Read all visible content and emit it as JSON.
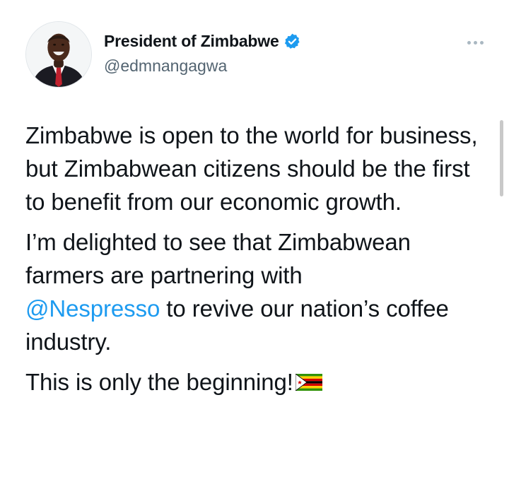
{
  "author": {
    "display_name": "President of Zimbabwe",
    "handle": "@edmnangagwa",
    "verified": true,
    "verified_color": "#1d9bf0"
  },
  "tweet": {
    "p1": "Zimbabwe is open to the world for business, but Zimbabwean citizens should be the first to benefit from our economic growth.",
    "p2_before": "I’m delighted to see that Zimbabwean farmers are partnering with",
    "p2_mention": "@Nespresso",
    "p2_after": " to revive our nation’s coffee industry.",
    "p3": "This is only the beginning!",
    "p3_emoji": "flag-zimbabwe",
    "mention_color": "#1d9bf0"
  },
  "icons": {
    "more": "more-horizontal-icon",
    "verified": "verified-badge-icon"
  }
}
